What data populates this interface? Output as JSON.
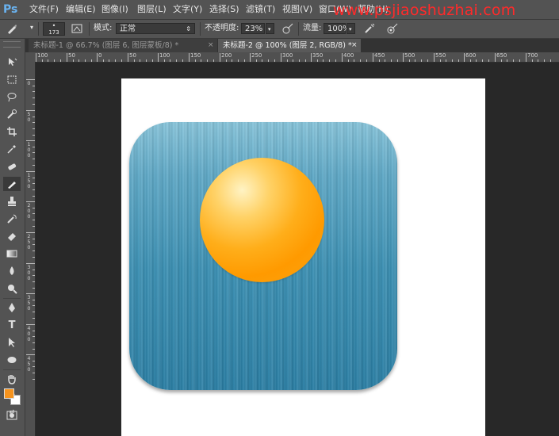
{
  "app": {
    "logo": "Ps"
  },
  "menu": [
    "文件(F)",
    "编辑(E)",
    "图像(I)",
    "图层(L)",
    "文字(Y)",
    "选择(S)",
    "滤镜(T)",
    "视图(V)",
    "窗口(W)",
    "帮助(H)"
  ],
  "watermark": "www.psjiaoshuzhai.com",
  "options": {
    "brush_size": "173",
    "mode_label": "模式:",
    "mode_value": "正常",
    "opacity_label": "不透明度:",
    "opacity_value": "23%",
    "flow_label": "流量:",
    "flow_value": "100%"
  },
  "tabs": [
    {
      "label": "未标题-1 @ 66.7% (图层 6, 图层蒙板/8) *",
      "close": "×"
    },
    {
      "label": "未标题-2 @ 100% (图层 2, RGB/8) *",
      "close": "×"
    }
  ],
  "hruler": [
    "100",
    "50",
    "0",
    "50",
    "100",
    "150",
    "200",
    "250",
    "300",
    "350",
    "400",
    "450",
    "500",
    "550",
    "600",
    "650",
    "700"
  ],
  "vruler": [
    "0",
    "5 0",
    "1 0 0",
    "1 5 0",
    "2 0 0",
    "2 5 0",
    "3 0 0",
    "3 5 0",
    "4 0 0",
    "4 5 0"
  ],
  "colors": {
    "foreground": "#f5931e",
    "background": "#ffffff",
    "icon_blue": "#3a8fb2",
    "sun_orange": "#ff9a00"
  },
  "tools": [
    "move-icon",
    "marquee-icon",
    "lasso-icon",
    "quick-select-icon",
    "crop-icon",
    "eyedropper-icon",
    "spot-heal-icon",
    "brush-icon",
    "stamp-icon",
    "history-brush-icon",
    "eraser-icon",
    "gradient-icon",
    "blur-icon",
    "dodge-icon",
    "pen-icon",
    "type-icon",
    "path-select-icon",
    "ellipse-icon",
    "hand-icon",
    "zoom-icon"
  ]
}
